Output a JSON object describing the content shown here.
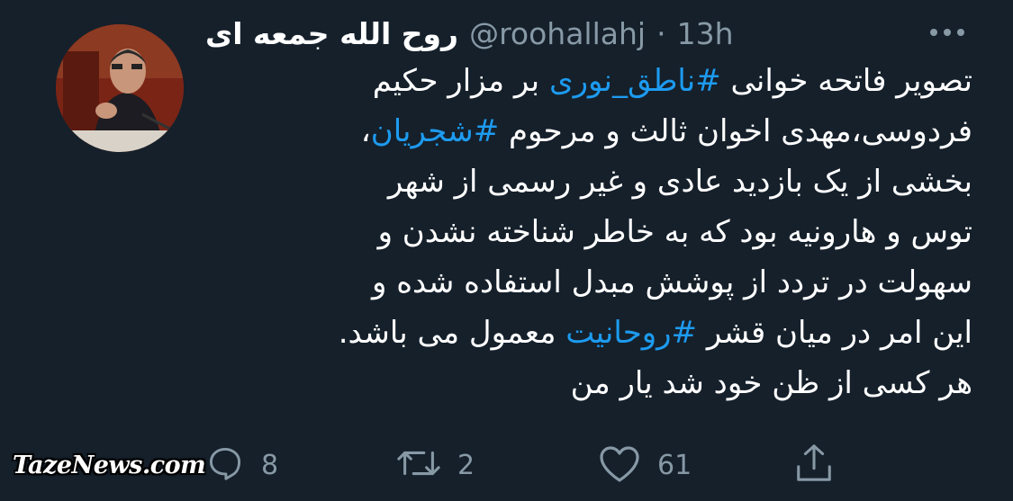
{
  "author": {
    "display_name": "روح الله جمعه ای",
    "handle": "@roohallahj",
    "separator": "·",
    "time": "13h"
  },
  "tweet": {
    "lines": [
      [
        {
          "text": "تصویر فاتحه خوانی ",
          "hashtag": false
        },
        {
          "text": "#ناطق_نوری",
          "hashtag": true
        },
        {
          "text": " بر مزار حکیم",
          "hashtag": false
        }
      ],
      [
        {
          "text": "فردوسی،مهدی اخوان ثالث و مرحوم ",
          "hashtag": false
        },
        {
          "text": "#شجریان",
          "hashtag": true
        },
        {
          "text": "،",
          "hashtag": false
        }
      ],
      [
        {
          "text": "بخشی از یک بازدید عادی و غیر رسمی از شهر",
          "hashtag": false
        }
      ],
      [
        {
          "text": "توس و هارونیه بود که به خاطر شناخته نشدن و",
          "hashtag": false
        }
      ],
      [
        {
          "text": "سهولت در تردد از پوشش مبدل استفاده شده و",
          "hashtag": false
        }
      ],
      [
        {
          "text": "این امر در میان قشر ",
          "hashtag": false
        },
        {
          "text": "#روحانیت",
          "hashtag": true
        },
        {
          "text": " معمول می باشد.",
          "hashtag": false
        }
      ],
      [
        {
          "text": "هر کسی از ظن خود شد یار من",
          "hashtag": false
        }
      ]
    ]
  },
  "actions": {
    "reply_count": "8",
    "retweet_count": "2",
    "like_count": "61"
  },
  "icons": {
    "more": "more-horizontal-icon",
    "reply": "reply-icon",
    "retweet": "retweet-icon",
    "like": "heart-icon",
    "share": "share-icon"
  },
  "watermark": "TazeNews.com",
  "colors": {
    "background": "#15202b",
    "text": "#ffffff",
    "secondary": "#8899a6",
    "hashtag": "#1d9bf0"
  }
}
